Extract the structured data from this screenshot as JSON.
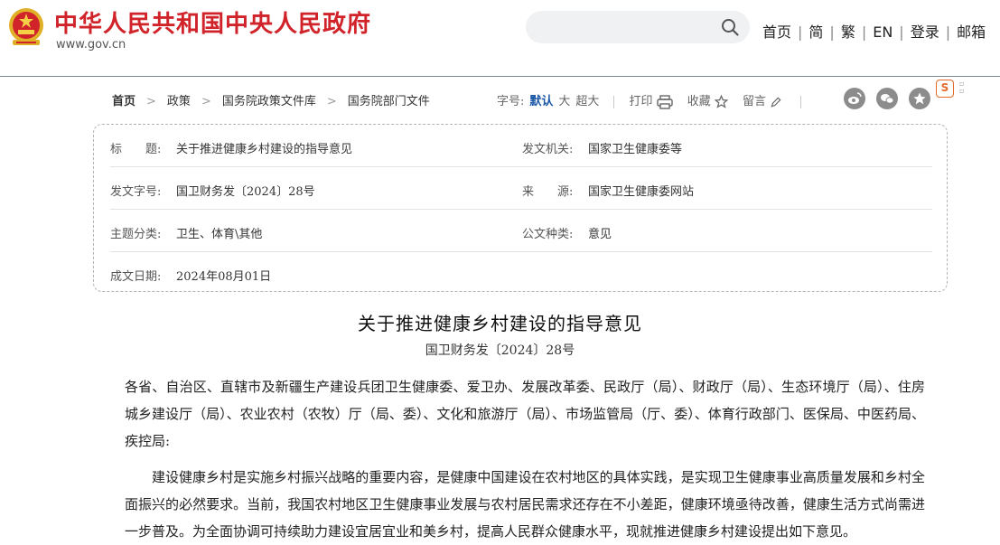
{
  "header": {
    "site_title": "中华人民共和国中央人民政府",
    "site_url": "www.gov.cn",
    "search_placeholder": "",
    "nav": [
      "首页",
      "简",
      "繁",
      "EN",
      "登录",
      "邮箱"
    ]
  },
  "breadcrumb": [
    "首页",
    "政策",
    "国务院政策文件库",
    "国务院部门文件"
  ],
  "tools": {
    "font_size_label": "字号:",
    "font_sizes": [
      "默认",
      "大",
      "超大"
    ],
    "active_font_size": "默认",
    "print": "打印",
    "favorite": "收藏",
    "comment": "留言"
  },
  "float_icon": "S",
  "meta": {
    "title_label": "标　　题:",
    "title_value": "关于推进健康乡村建设的指导意见",
    "issuer_label": "发文机关:",
    "issuer_value": "国家卫生健康委等",
    "doc_no_label": "发文字号:",
    "doc_no_value": "国卫财务发〔2024〕28号",
    "source_label": "来　　源:",
    "source_value": "国家卫生健康委网站",
    "category_label": "主题分类:",
    "category_value": "卫生、体育\\其他",
    "type_label": "公文种类:",
    "type_value": "意见",
    "date_label": "成文日期:",
    "date_value": "2024年08月01日"
  },
  "article": {
    "title": "关于推进健康乡村建设的指导意见",
    "doc_number": "国卫财务发〔2024〕28号",
    "recipients": "各省、自治区、直辖市及新疆生产建设兵团卫生健康委、爱卫办、发展改革委、民政厅（局）、财政厅（局）、生态环境厅（局）、住房城乡建设厅（局）、农业农村（农牧）厅（局、委）、文化和旅游厅（局）、市场监管局（厅、委）、体育行政部门、医保局、中医药局、疾控局:",
    "paragraph1": "建设健康乡村是实施乡村振兴战略的重要内容，是健康中国建设在农村地区的具体实践，是实现卫生健康事业高质量发展和乡村全面振兴的必然要求。当前，我国农村地区卫生健康事业发展与农村居民需求还存在不小差距，健康环境亟待改善，健康生活方式尚需进一步普及。为全面协调可持续助力建设宜居宜业和美乡村，提高人民群众健康水平，现就推进健康乡村建设提出如下意见。"
  },
  "colors": {
    "brand_red": "#d0232a",
    "link_blue": "#1a57a6",
    "header_rule": "#7a8799"
  }
}
